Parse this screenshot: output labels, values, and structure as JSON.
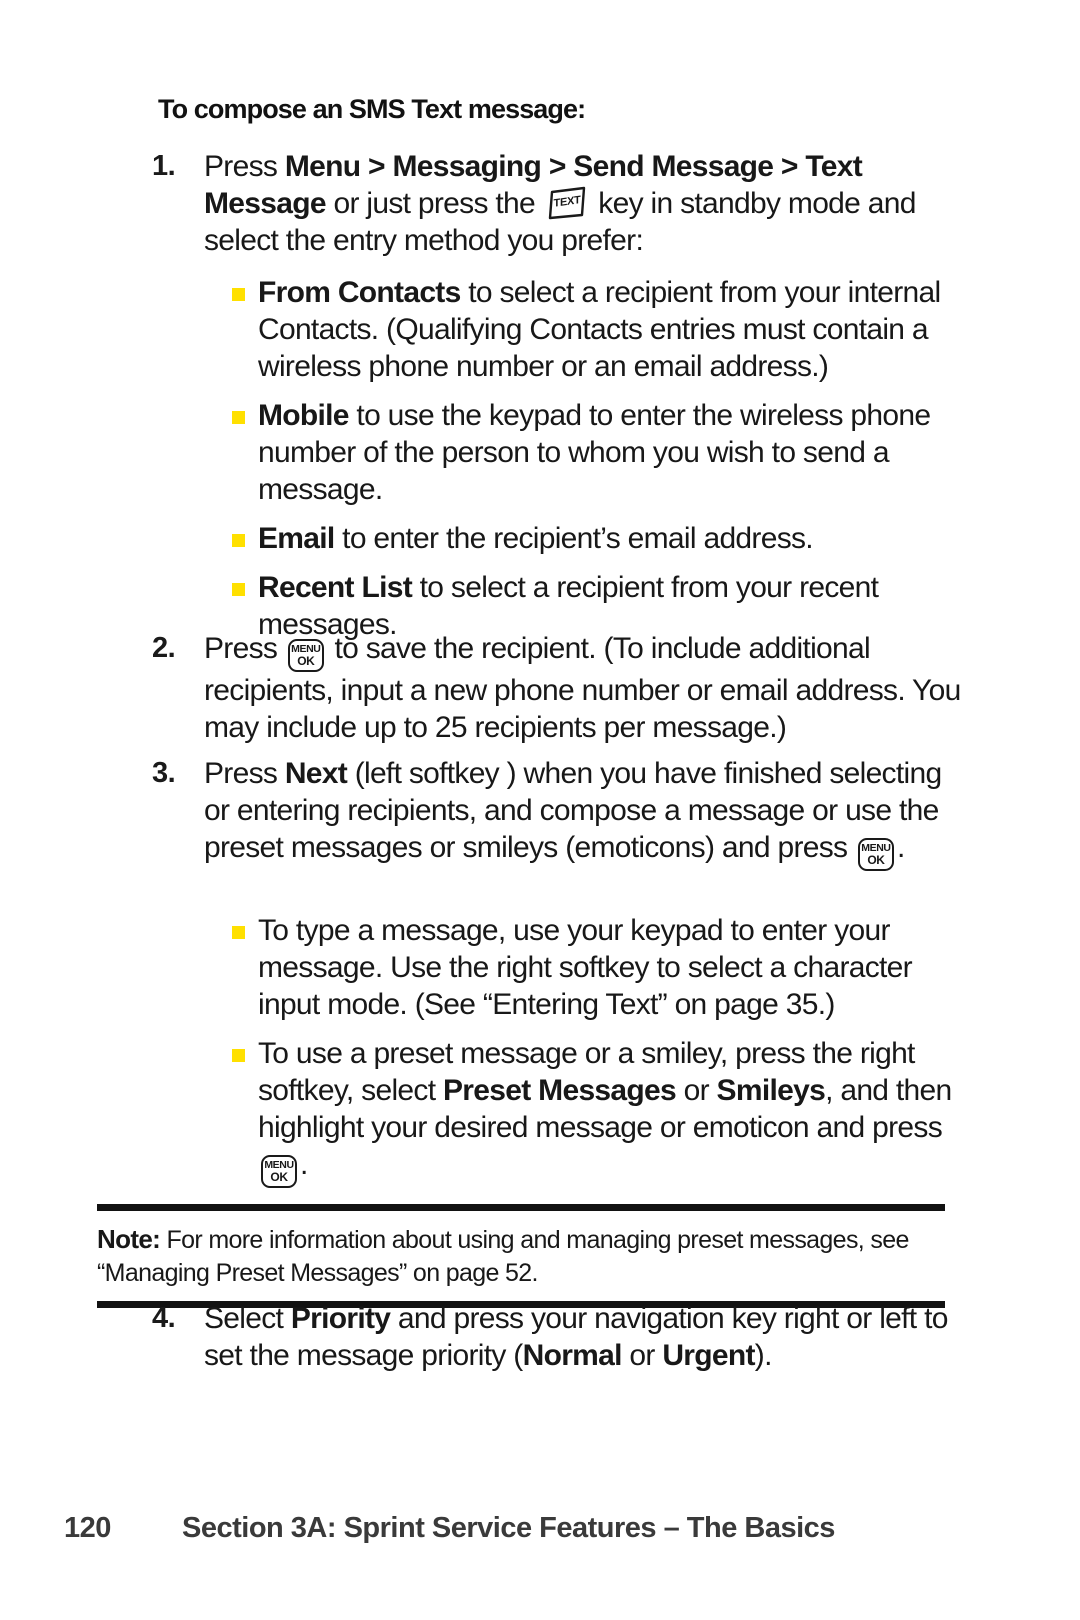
{
  "page": {
    "heading": "To compose an SMS Text message:",
    "number": "120",
    "footer_title": "Section 3A: Sprint Service Features – The Basics"
  },
  "colors": {
    "bullet": "#FFE000",
    "text": "#181818",
    "rule": "#121212",
    "footer": "#3A3A3A"
  },
  "icons": {
    "text_key": "TEXT",
    "menu_key_line1": "MENU",
    "menu_key_line2": "OK"
  },
  "steps": [
    {
      "num": "1.",
      "lead": "Press ",
      "bold1": "Menu > Messaging > Send Message > Text Message",
      "mid": " or just press the ",
      "tail": " key in standby mode and select the entry method you prefer:",
      "bullets": [
        {
          "bold": "From Contacts",
          "rest": " to select a recipient from your internal Contacts. (Qualifying Contacts entries must contain a wireless phone number or an email address.)"
        },
        {
          "bold": "Mobile",
          "rest": " to use the keypad to enter the wireless phone number of the person to whom you wish to send a message."
        },
        {
          "bold": "Email",
          "rest": " to enter the recipient’s email address."
        },
        {
          "bold": "Recent List",
          "rest": " to select a recipient from your recent messages."
        }
      ]
    },
    {
      "num": "2.",
      "lead": "Press ",
      "tail": " to save the recipient. (To include additional recipients, input a new phone number or email address. You may include up to 25 recipients per message.)"
    },
    {
      "num": "3.",
      "lead": "Press ",
      "bold1": "Next",
      "mid": " (left softkey ) when you have finished selecting or entering recipients, and compose a message or use the preset messages or smileys (emoticons) and press ",
      "tail": ".",
      "bullets": [
        {
          "bold": "",
          "rest": "To type a message, use your keypad to enter your message. Use the right softkey to select a character input mode. (See “Entering Text” on page 35.)"
        },
        {
          "pre": "To use a preset  message or a smiley, press the right softkey, select ",
          "bold": "Preset Messages",
          "mid": " or ",
          "bold2": "Smileys",
          "rest": ", and then highlight your desired message or emoticon and press ",
          "post": "."
        }
      ]
    },
    {
      "num": "4.",
      "lead": "Select ",
      "bold1": "Priority",
      "mid": " and press your navigation key right or left to set the message priority (",
      "bold2": "Normal",
      "mid2": " or ",
      "bold3": "Urgent",
      "tail": ")."
    }
  ],
  "note": {
    "label": "Note:",
    "line1": " For more information about using and managing preset  messages,",
    "line2": "see “Managing Preset Messages” on page 52."
  }
}
